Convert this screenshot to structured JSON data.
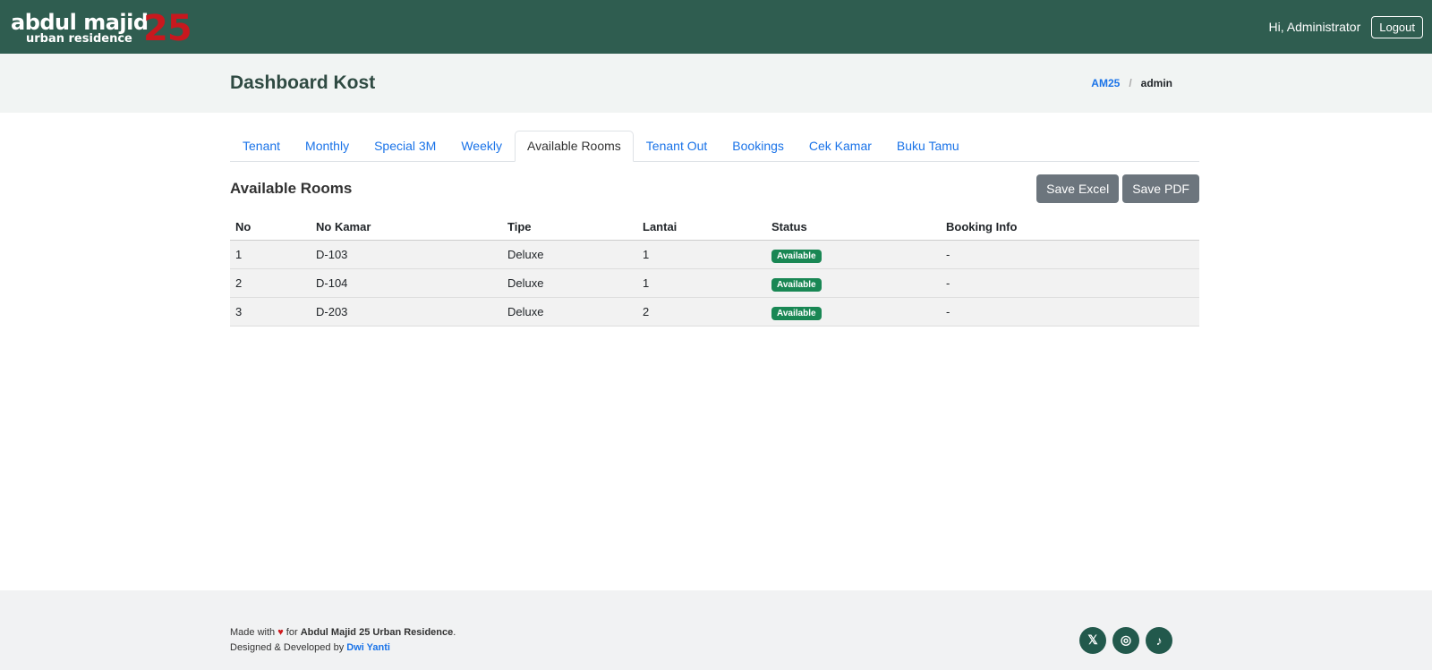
{
  "brand": {
    "line1": "abdul majid",
    "line2": "urban residence",
    "number": "25"
  },
  "user": {
    "greeting": "Hi, Administrator",
    "logout": "Logout"
  },
  "header": {
    "title": "Dashboard Kost",
    "breadcrumb": [
      "AM25",
      "/",
      "admin"
    ]
  },
  "tabs": [
    "Tenant",
    "Monthly",
    "Special 3M",
    "Weekly",
    "Available Rooms",
    "Tenant Out",
    "Bookings",
    "Cek Kamar",
    "Buku Tamu"
  ],
  "section": {
    "title": "Available Rooms",
    "save_excel": "Save Excel",
    "save_pdf": "Save PDF"
  },
  "table": {
    "headers": [
      "No",
      "No Kamar",
      "Tipe",
      "Lantai",
      "Status",
      "Booking Info"
    ],
    "rows": [
      [
        "1",
        "D-103",
        "Deluxe",
        "1",
        "Available",
        "-"
      ],
      [
        "2",
        "D-104",
        "Deluxe",
        "1",
        "Available",
        "-"
      ],
      [
        "3",
        "D-203",
        "Deluxe",
        "2",
        "Available",
        "-"
      ]
    ]
  },
  "footer": {
    "made": "Made with",
    "heart": "♥",
    "for": "for",
    "org": "Abdul Majid 25 Urban Residence",
    "dot": ".",
    "designed": "Designed & Developed by",
    "dev": "Dwi Yanti",
    "social": [
      "𝕏",
      "◎",
      "♪"
    ]
  }
}
